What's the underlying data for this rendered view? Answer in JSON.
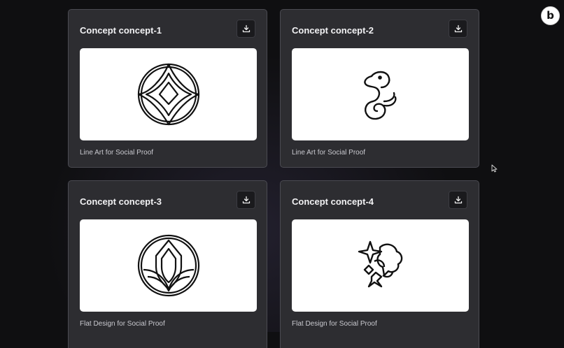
{
  "cards": [
    {
      "title": "Concept concept-1",
      "caption": "Line Art for Social Proof",
      "icon": "nested-diamond-emblem-icon"
    },
    {
      "title": "Concept concept-2",
      "caption": "Line Art for Social Proof",
      "icon": "seahorse-swirl-icon"
    },
    {
      "title": "Concept concept-3",
      "caption": "Flat Design for Social Proof",
      "icon": "shield-leaf-emblem-icon"
    },
    {
      "title": "Concept concept-4",
      "caption": "Flat Design for Social Proof",
      "icon": "sparkle-cluster-icon"
    }
  ],
  "download_icon": "download-icon",
  "brand": {
    "letter": "b",
    "icon": "brand-logo-badge"
  },
  "colors": {
    "background": "#0f0f11",
    "card": "#2d2d31",
    "card_border": "#4b4b52",
    "preview": "#ffffff"
  }
}
